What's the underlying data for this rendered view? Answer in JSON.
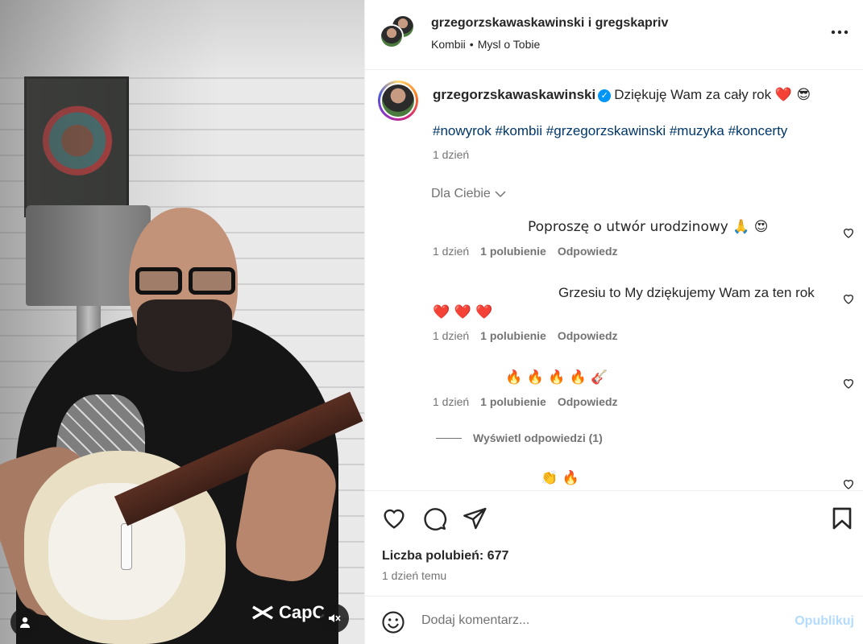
{
  "media": {
    "watermark": "CapC",
    "icons": {
      "profile": "person-icon",
      "mute": "muted-speaker-icon"
    }
  },
  "header": {
    "names": "grzegorzskawaskawinski i gregskapriv",
    "artist": "Kombii",
    "song": "Mysl o Tobie"
  },
  "caption": {
    "username": "grzegorzskawaskawinski",
    "text": "Dziękuję Wam za cały rok",
    "emojis": "❤️ 😎",
    "hashtags": "#nowyrok #kombii #grzegorzskawinski #muzyka #koncerty",
    "time": "1 dzień"
  },
  "sort_label": "Dla Ciebie",
  "comments": [
    {
      "text": "Poproszę o utwór urodzinowy 🙏 😍",
      "time": "1 dzień",
      "likes": "1 polubienie",
      "reply": "Odpowiedz"
    },
    {
      "text": "Grzesiu to My dziękujemy Wam za ten rok",
      "text2": "❤️ ❤️ ❤️",
      "time": "1 dzień",
      "likes": "1 polubienie",
      "reply": "Odpowiedz"
    },
    {
      "text": "🔥 🔥 🔥 🔥 🎸",
      "time": "1 dzień",
      "likes": "1 polubienie",
      "reply": "Odpowiedz"
    },
    {
      "text": "👏 🔥"
    }
  ],
  "view_replies": "Wyświetl odpowiedzi (1)",
  "likes_count": "Liczba polubień: 677",
  "posted": "1 dzień temu",
  "composer": {
    "placeholder": "Dodaj komentarz...",
    "publish": "Opublikuj"
  }
}
